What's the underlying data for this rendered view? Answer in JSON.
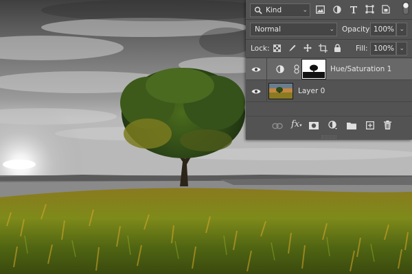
{
  "panel": {
    "filter_kind": "Kind",
    "blend_mode": "Normal",
    "opacity_label": "Opacity:",
    "opacity_value": "100%",
    "lock_label": "Lock:",
    "fill_label": "Fill:",
    "fill_value": "100%"
  },
  "layers": [
    {
      "name": "Hue/Saturation 1",
      "type": "adjustment",
      "visible": true,
      "selected": true
    },
    {
      "name": "Layer 0",
      "type": "pixel",
      "visible": true,
      "selected": false
    }
  ],
  "footer_icons": [
    "link-icon",
    "fx-icon",
    "add-mask-icon",
    "new-fill-adjustment-icon",
    "new-group-icon",
    "new-layer-icon",
    "delete-icon"
  ],
  "colors": {
    "panel_bg": "#535353",
    "selected_row": "#686868",
    "field_bg": "#454545"
  }
}
